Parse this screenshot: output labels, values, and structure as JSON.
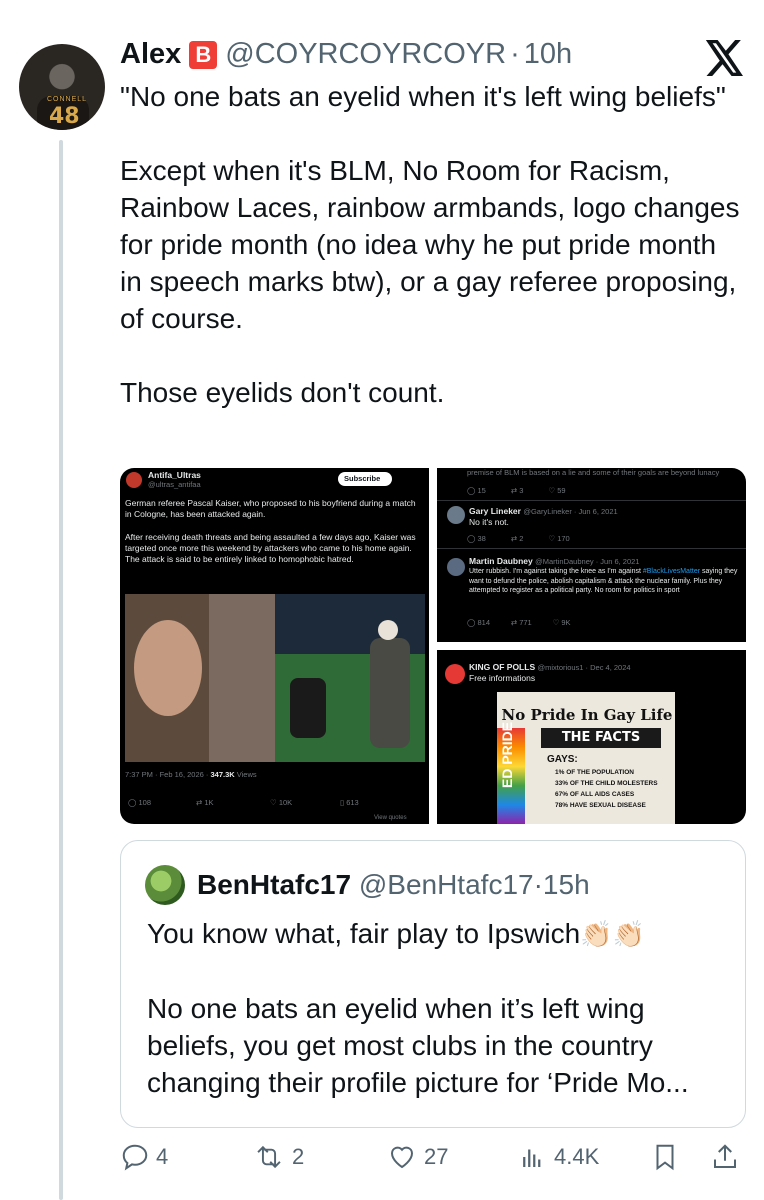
{
  "tweet": {
    "author_name": "Alex",
    "badge_letter": "B",
    "handle": "@COYRCOYRCOYR",
    "separator": "·",
    "time": "10h",
    "avatar_number": "48",
    "avatar_name": "CONNELL",
    "paragraphs": [
      "\"No one bats an eyelid when it's left wing beliefs\"",
      "Except when it's BLM, No Room for Racism, Rainbow Laces, rainbow armbands, logo changes for pride month (no idea why he put pride month in speech marks btw), or a gay referee proposing, of course.",
      "Those eyelids don't count."
    ]
  },
  "media1": {
    "account_name": "Antifa_Ultras",
    "account_handle": "@ultras_antifaa",
    "subscribe_label": "Subscribe",
    "text1": "German referee Pascal Kaiser, who proposed to his boyfriend during a match in Cologne, has been attacked again.",
    "text2": "After receiving death threats and being assaulted a few days ago, Kaiser was targeted once more this weekend by attackers who came to his home again. The attack is said to be entirely linked to homophobic hatred.",
    "timestamp": "7:37 PM · Feb 16, 2026 ·",
    "views": "347.3K",
    "views_label": "Views",
    "replies": "108",
    "reposts": "1K",
    "likes": "10K",
    "bookmarks": "613",
    "view_quotes": "View quotes"
  },
  "media2": {
    "top_text": "premise of BLM is based on a lie and some of their goals are beyond lunacy",
    "row1": {
      "replies": "15",
      "reposts": "3",
      "likes": "59"
    },
    "reply1": {
      "name": "Gary Lineker",
      "handle": "@GaryLineker · Jun 6, 2021",
      "text": "No it's not."
    },
    "row2": {
      "replies": "38",
      "reposts": "2",
      "likes": "170"
    },
    "reply2": {
      "name": "Martin Daubney",
      "handle": "@MartinDaubney · Jun 6, 2021",
      "text_a": "Utter rubbish. I'm against taking the knee as I'm against ",
      "hashtag": "#BlackLivesMatter",
      "text_b": " saying they want to defund the police, abolish capitalism & attack the nuclear family. Plus they attempted to register as a political party. No room for politics in sport"
    },
    "row3": {
      "replies": "814",
      "reposts": "771",
      "likes": "9K"
    }
  },
  "media3": {
    "name": "KING OF POLLS",
    "handle": "@mixtorious1 · Dec 4, 2024",
    "subtext": "Free informations",
    "headline": "No Pride In Gay Life",
    "facts_title": "THE FACTS",
    "gays_label": "GAYS:",
    "fact1": "1% OF THE POPULATION",
    "fact2": "33% OF THE CHILD MOLESTERS",
    "fact3": "67% OF ALL AIDS CASES",
    "fact4": "78% HAVE SEXUAL DISEASE",
    "side_text": "ED PRIDE"
  },
  "quote": {
    "name": "BenHtafc17",
    "handle": "@BenHtafc17",
    "separator": "·",
    "time": "15h",
    "line1": "You know what, fair play to Ipswich",
    "claps": "👏🏻👏🏻",
    "paragraph2": "No one bats an eyelid when it’s left wing beliefs, you get most clubs in the country changing their profile picture for ‘Pride Mo..."
  },
  "actions": {
    "replies": "4",
    "reposts": "2",
    "likes": "27",
    "views": "4.4K"
  },
  "colors": {
    "text": "#0f1419",
    "secondary": "#536471",
    "border": "#cfd9de",
    "badge": "#ef3e36",
    "link": "#1d9bf0"
  }
}
